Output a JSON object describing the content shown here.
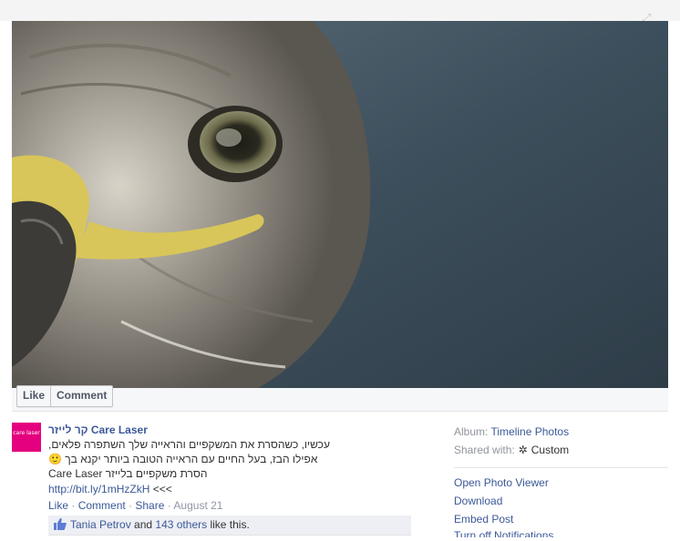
{
  "post": {
    "page_name": "קר לייזר Care Laser",
    "avatar_text": "care laser",
    "message_lines": [
      "עכשיו, כשהסרת את המשקפיים והראייה שלך השתפרה פלאים,",
      "אפילו הבז, בעל החיים עם הראייה הטובה ביותר יקנא בך 🙂",
      "Care Laser הסרת משקפיים בלייזר"
    ],
    "link": "http://bit.ly/1mHzZkH",
    "link_suffix": " <<<",
    "actions": {
      "like": "Like",
      "comment": "Comment",
      "share": "Share",
      "separator": " · ",
      "date": "August 21"
    },
    "likes": {
      "user": "Tania Petrov",
      "and": " and ",
      "others": "143 others",
      "suffix": " like this."
    }
  },
  "photo_actions": {
    "like": "Like",
    "comment": "Comment"
  },
  "sidebar": {
    "album_label": "Album:",
    "album_value": "Timeline Photos",
    "shared_label": "Shared with:",
    "shared_value": "Custom",
    "actions": [
      "Open Photo Viewer",
      "Download",
      "Embed Post"
    ],
    "cut_item": "Turn off Notifications"
  },
  "colors": {
    "link": "#3b5998",
    "brand": "#e4007f",
    "muted": "#9197a3"
  },
  "icons": {
    "expand": "expand-icon",
    "shared": "gear-icon",
    "like": "thumbs-up-icon"
  }
}
